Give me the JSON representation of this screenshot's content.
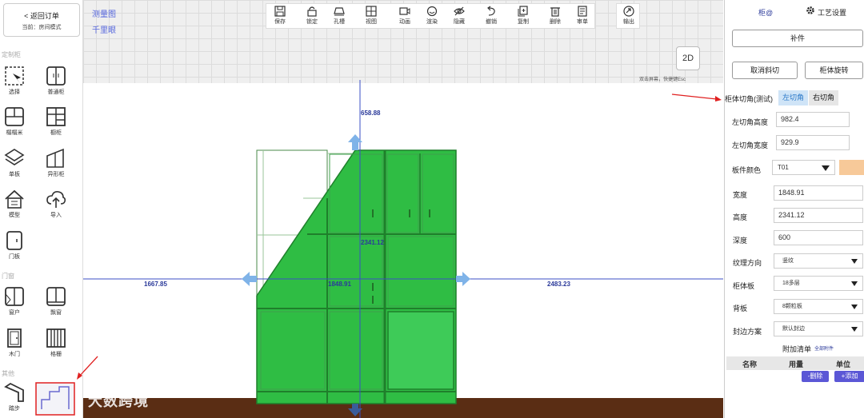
{
  "left_panel": {
    "back_label": "< 返回订单",
    "mode_label": "当前：房间模式",
    "group_custom": "定制柜",
    "group_doors": "门窗",
    "group_other": "其他",
    "tools": [
      {
        "label": "选择",
        "icon": "cursor-icon"
      },
      {
        "label": "普通柜",
        "icon": "cabinet-icon"
      },
      {
        "label": "榻榻米",
        "icon": "tatami-icon"
      },
      {
        "label": "橱柜",
        "icon": "kitchen-cabinet-icon"
      },
      {
        "label": "单板",
        "icon": "board-icon"
      },
      {
        "label": "异形柜",
        "icon": "shaped-cabinet-icon"
      },
      {
        "label": "模型",
        "icon": "house-icon"
      },
      {
        "label": "导入",
        "icon": "upload-cloud-icon"
      },
      {
        "label": "门板",
        "icon": "door-panel-icon"
      },
      {
        "label": "窗户",
        "icon": "window-icon"
      },
      {
        "label": "飘窗",
        "icon": "bay-window-icon"
      },
      {
        "label": "木门",
        "icon": "wood-door-icon"
      },
      {
        "label": "格栅",
        "icon": "grille-icon"
      },
      {
        "label": "踏步",
        "icon": "step-icon"
      }
    ]
  },
  "canvas": {
    "link_measure": "测量图",
    "link_far": "千里眼",
    "toolbar": [
      {
        "label": "保存",
        "icon": "save-icon",
        "dropdown": true
      },
      {
        "label": "锁定",
        "icon": "lock-icon",
        "dropdown": false
      },
      {
        "label": "孔槽",
        "icon": "hole-slot-icon",
        "dropdown": true
      },
      {
        "label": "视图",
        "icon": "view-grid-icon",
        "dropdown": true
      },
      {
        "label": "动画",
        "icon": "video-icon",
        "dropdown": false
      },
      {
        "label": "渲染",
        "icon": "render-icon",
        "dropdown": false
      },
      {
        "label": "隐藏",
        "icon": "eye-hidden-icon",
        "dropdown": true
      },
      {
        "label": "撤销",
        "icon": "undo-icon",
        "dropdown": true
      },
      {
        "label": "复制",
        "icon": "copy-icon",
        "dropdown": true
      },
      {
        "label": "删除",
        "icon": "trash-icon",
        "dropdown": false
      },
      {
        "label": "审单",
        "icon": "audit-icon",
        "dropdown": false
      }
    ],
    "export_label": "输出",
    "view_2d": "2D",
    "view_hint": "双击屏幕，快捷键Esc",
    "dims": {
      "top": "658.88",
      "height": "2341.12",
      "left": "1667.85",
      "width": "1848.91",
      "right": "2483.23"
    },
    "watermark": "大数跨境"
  },
  "right_panel": {
    "tab_cabinet": "柜@",
    "tab_process": "工艺设置",
    "btn_patch": "补件",
    "btn_cancel_bevel": "取消斜切",
    "btn_rotate": "柜体旋转",
    "corner_label": "柜体切角(测试)",
    "corner_left": "左切角",
    "corner_right": "右切角",
    "left_corner_height_label": "左切角高度",
    "left_corner_height": "982.4",
    "left_corner_width_label": "左切角宽度",
    "left_corner_width": "929.9",
    "board_color_label": "板件颜色",
    "board_color": "T01",
    "board_color_swatch": "#f7c999",
    "width_label": "宽度",
    "width": "1848.91",
    "height_label": "高度",
    "height": "2341.12",
    "depth_label": "深度",
    "depth": "600",
    "grain_label": "纹理方向",
    "grain": "竖纹",
    "board_label": "柜体板",
    "board": "18多层",
    "back_label": "背板",
    "back": "8颗粒板",
    "edge_label": "封边方案",
    "edge": "默认封边",
    "extra_title": "附加清单",
    "extra_all": "全部附件",
    "col_name": "名称",
    "col_qty": "用量",
    "col_unit": "单位",
    "btn_delete": "-删除",
    "btn_add": "+添加"
  },
  "colors": {
    "cabinet_green": "#2fbd44",
    "cabinet_dark": "#1f7f2b",
    "dimension_blue": "#3b4fc4",
    "arrow_blue": "#7fb3e8",
    "floor": "#5a2d14",
    "annotation_red": "#e02020"
  }
}
